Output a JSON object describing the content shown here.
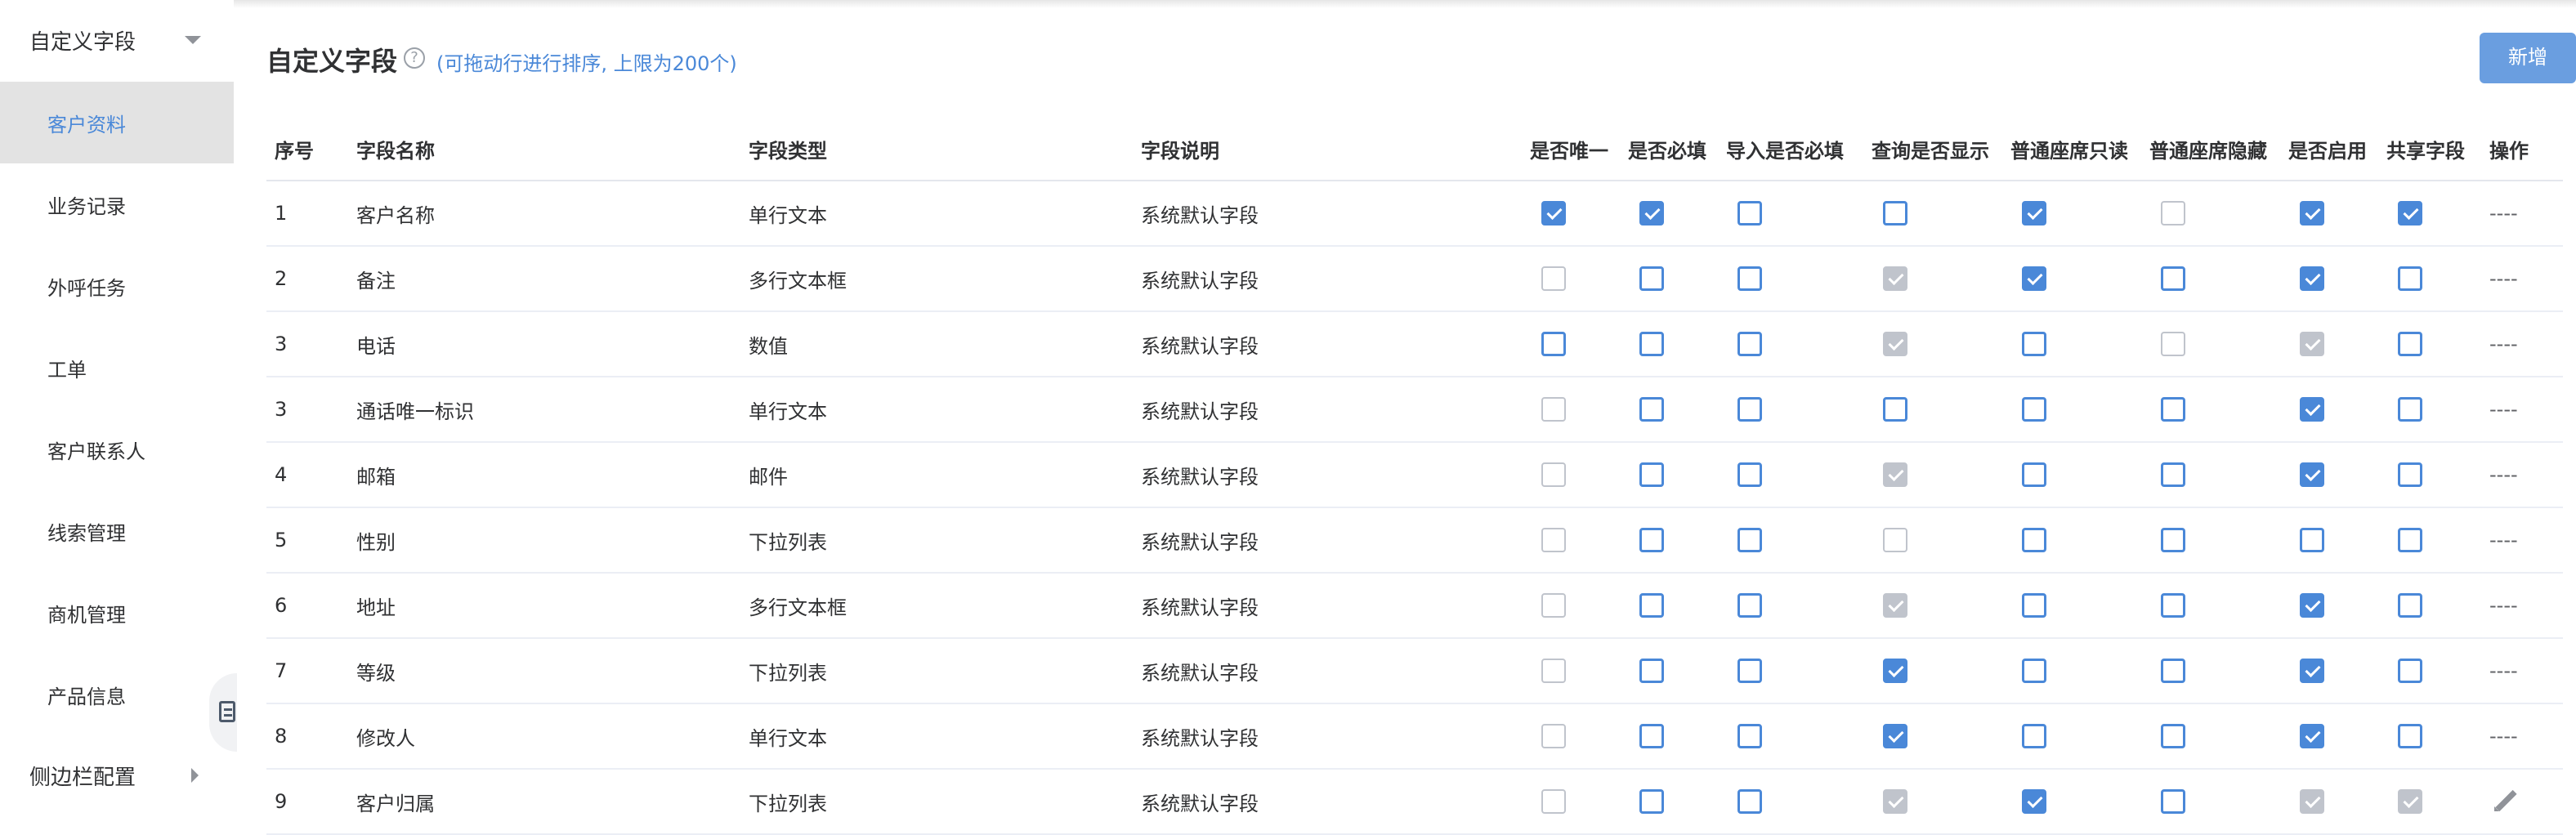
{
  "sidebar": {
    "group_title": "自定义字段",
    "items": [
      {
        "label": "客户资料",
        "active": true
      },
      {
        "label": "业务记录",
        "active": false
      },
      {
        "label": "外呼任务",
        "active": false
      },
      {
        "label": "工单",
        "active": false
      },
      {
        "label": "客户联系人",
        "active": false
      },
      {
        "label": "线索管理",
        "active": false
      },
      {
        "label": "商机管理",
        "active": false
      },
      {
        "label": "产品信息",
        "active": false
      }
    ],
    "footer_group": "侧边栏配置"
  },
  "header": {
    "title": "自定义字段",
    "hint": "(可拖动行进行排序, 上限为200个)",
    "add_button": "新增"
  },
  "table": {
    "columns": [
      "序号",
      "字段名称",
      "字段类型",
      "字段说明",
      "是否唯一",
      "是否必填",
      "导入是否必填",
      "查询是否显示",
      "普通座席只读",
      "普通座席隐藏",
      "是否启用",
      "共享字段",
      "操作"
    ],
    "rows": [
      {
        "no": "1",
        "name": "客户名称",
        "type": "单行文本",
        "desc": "系统默认字段",
        "flags": [
          "on",
          "on",
          "off",
          "off",
          "on",
          "dis-off",
          "on",
          "on"
        ],
        "action": "----"
      },
      {
        "no": "2",
        "name": "备注",
        "type": "多行文本框",
        "desc": "系统默认字段",
        "flags": [
          "dis-off",
          "off",
          "off",
          "dis-on",
          "on",
          "off",
          "on",
          "off"
        ],
        "action": "----"
      },
      {
        "no": "3",
        "name": "电话",
        "type": "数值",
        "desc": "系统默认字段",
        "flags": [
          "off",
          "off",
          "off",
          "dis-on",
          "off",
          "dis-off",
          "dis-on",
          "off"
        ],
        "action": "----"
      },
      {
        "no": "3",
        "name": "通话唯一标识",
        "type": "单行文本",
        "desc": "系统默认字段",
        "flags": [
          "dis-off",
          "off",
          "off",
          "off",
          "off",
          "off",
          "on",
          "off"
        ],
        "action": "----"
      },
      {
        "no": "4",
        "name": "邮箱",
        "type": "邮件",
        "desc": "系统默认字段",
        "flags": [
          "dis-off",
          "off",
          "off",
          "dis-on",
          "off",
          "off",
          "on",
          "off"
        ],
        "action": "----"
      },
      {
        "no": "5",
        "name": "性别",
        "type": "下拉列表",
        "desc": "系统默认字段",
        "flags": [
          "dis-off",
          "off",
          "off",
          "dis-off",
          "off",
          "off",
          "off",
          "off"
        ],
        "action": "----"
      },
      {
        "no": "6",
        "name": "地址",
        "type": "多行文本框",
        "desc": "系统默认字段",
        "flags": [
          "dis-off",
          "off",
          "off",
          "dis-on",
          "off",
          "off",
          "on",
          "off"
        ],
        "action": "----"
      },
      {
        "no": "7",
        "name": "等级",
        "type": "下拉列表",
        "desc": "系统默认字段",
        "flags": [
          "dis-off",
          "off",
          "off",
          "on",
          "off",
          "off",
          "on",
          "off"
        ],
        "action": "----"
      },
      {
        "no": "8",
        "name": "修改人",
        "type": "单行文本",
        "desc": "系统默认字段",
        "flags": [
          "dis-off",
          "off",
          "off",
          "on",
          "off",
          "off",
          "on",
          "off"
        ],
        "action": "----"
      },
      {
        "no": "9",
        "name": "客户归属",
        "type": "下拉列表",
        "desc": "系统默认字段",
        "flags": [
          "dis-off",
          "off",
          "off",
          "dis-on",
          "on",
          "off",
          "dis-on",
          "dis-on"
        ],
        "action": "edit-icon"
      }
    ]
  },
  "colors": {
    "primary": "#4a88d8",
    "button": "#6a9ee0",
    "active_bg": "#e3e3e3",
    "disabled": "#c0c4cc"
  }
}
